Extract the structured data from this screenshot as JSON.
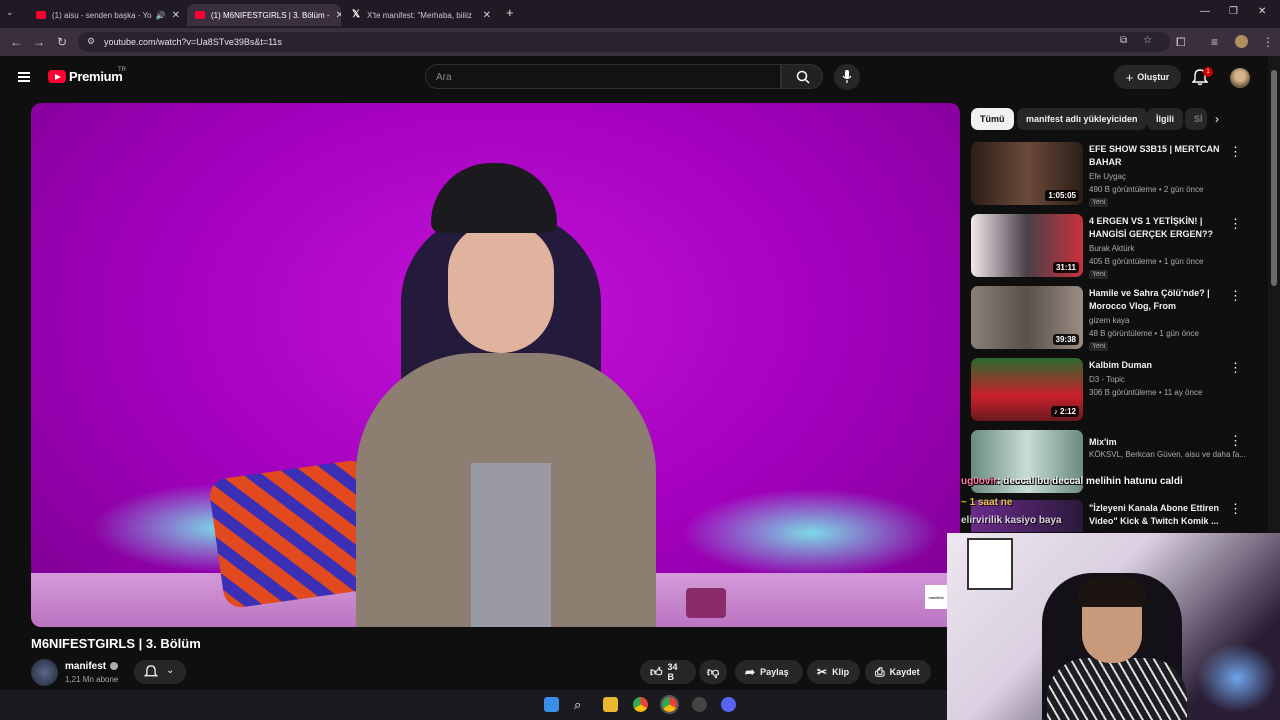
{
  "browser": {
    "tabs": [
      {
        "title": "(1) aisu - senden başka - Yo",
        "icon": "youtube-icon",
        "audio": true
      },
      {
        "title": "(1) M6NIFESTGIRLS | 3. Bölüm -",
        "icon": "youtube-icon",
        "active": true
      },
      {
        "title": "X'te manifest: \"Merhaba, biiiiz",
        "icon": "x-icon"
      }
    ],
    "new_tab": "+",
    "url": "youtube.com/watch?v=Ua8STve39Bs&t=11s"
  },
  "header": {
    "logo": "Premium",
    "region": "TR",
    "search_placeholder": "Ara",
    "create_label": "Oluştur",
    "notification_count": "1"
  },
  "video": {
    "title": "M6NIFESTGIRLS | 3. Bölüm",
    "channel": "manifest",
    "subscribers": "1,21 Mn abone",
    "likes": "34 B",
    "share": "Paylaş",
    "clip": "Klip",
    "save": "Kaydet"
  },
  "chips": [
    "Tümü",
    "manifest adlı yükleyiciden",
    "İlgili",
    "Sİ"
  ],
  "recommendations": [
    {
      "title": "EFE SHOW S3B15 | MERTCAN BAHAR",
      "channel": "Efe Uygaç",
      "meta": "490 B görüntüleme • 2 gün önce",
      "duration": "1:05:05",
      "badge": "Yeni",
      "thumb_color": "#3c2b22"
    },
    {
      "title": "4 ERGEN VS 1 YETİŞKİN! | HANGİSİ GERÇEK ERGEN?? ...",
      "channel": "Burak Aktürk",
      "meta": "405 B görüntüleme • 1 gün önce",
      "duration": "31:11",
      "badge": "Yeni",
      "thumb_color": "#5a5058"
    },
    {
      "title": "Hamile ve Sahra Çölü'nde? | Morocco Vlog, From Marrakes...",
      "channel": "gizem kaya",
      "meta": "48 B görüntüleme • 1 gün önce",
      "duration": "39:38",
      "badge": "Yeni",
      "thumb_color": "#6a6058"
    },
    {
      "title": "Kalbim Duman",
      "channel": "D3 - Topic",
      "meta": "306 B görüntüleme • 11 ay önce",
      "duration": "♪ 2:12",
      "badge": "",
      "thumb_color": "#b01c24"
    },
    {
      "title": "Mix'im",
      "channel": "KÖKSVL, Berkcan Güven, aisu ve daha fa...",
      "meta": "",
      "duration": "",
      "badge": "",
      "thumb_color": "#a8bfb8"
    },
    {
      "title": "\"İzleyeni Kanala Abone Ettiren Video\" Kick & Twitch Komik ...",
      "channel": "",
      "meta": "",
      "duration": "",
      "badge": "",
      "thumb_color": "#3a2a4a"
    }
  ],
  "chat": {
    "line1_user": "ug0ovir",
    "line1_text": ": deccal bu deccal melihin hatunu caldi",
    "line2": "~ 1 saat ne",
    "line3": "elirvirilik kasiyo baya"
  },
  "overlay_label": "manifest",
  "colors": {
    "accent_red": "#ff0033",
    "background": "#0f0f0f",
    "purple_bg": "#b30acb"
  }
}
